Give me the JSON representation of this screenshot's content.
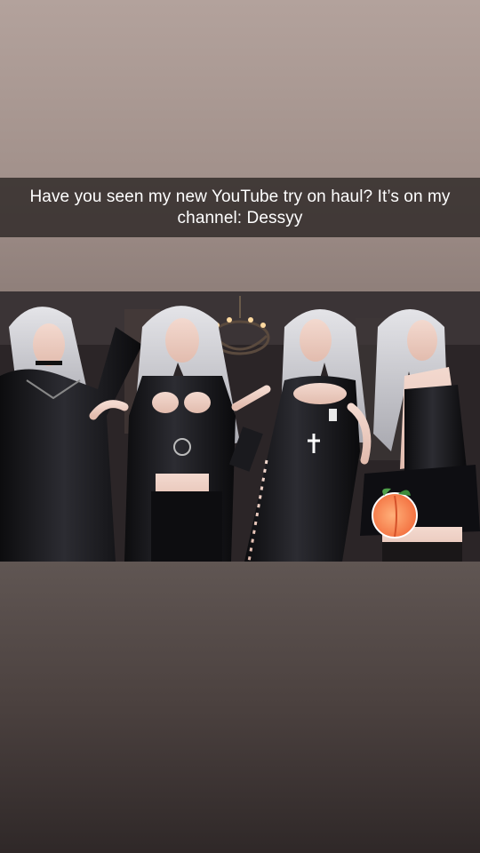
{
  "story": {
    "caption": "Have you seen my new YouTube try on haul? It’s on my channel: Dessyy",
    "background_top": "#b3a29c",
    "background_bottom": "#2f2828"
  },
  "thumbnail": {
    "subject": "four gothic outfits",
    "sticker": "peach-emoji"
  }
}
